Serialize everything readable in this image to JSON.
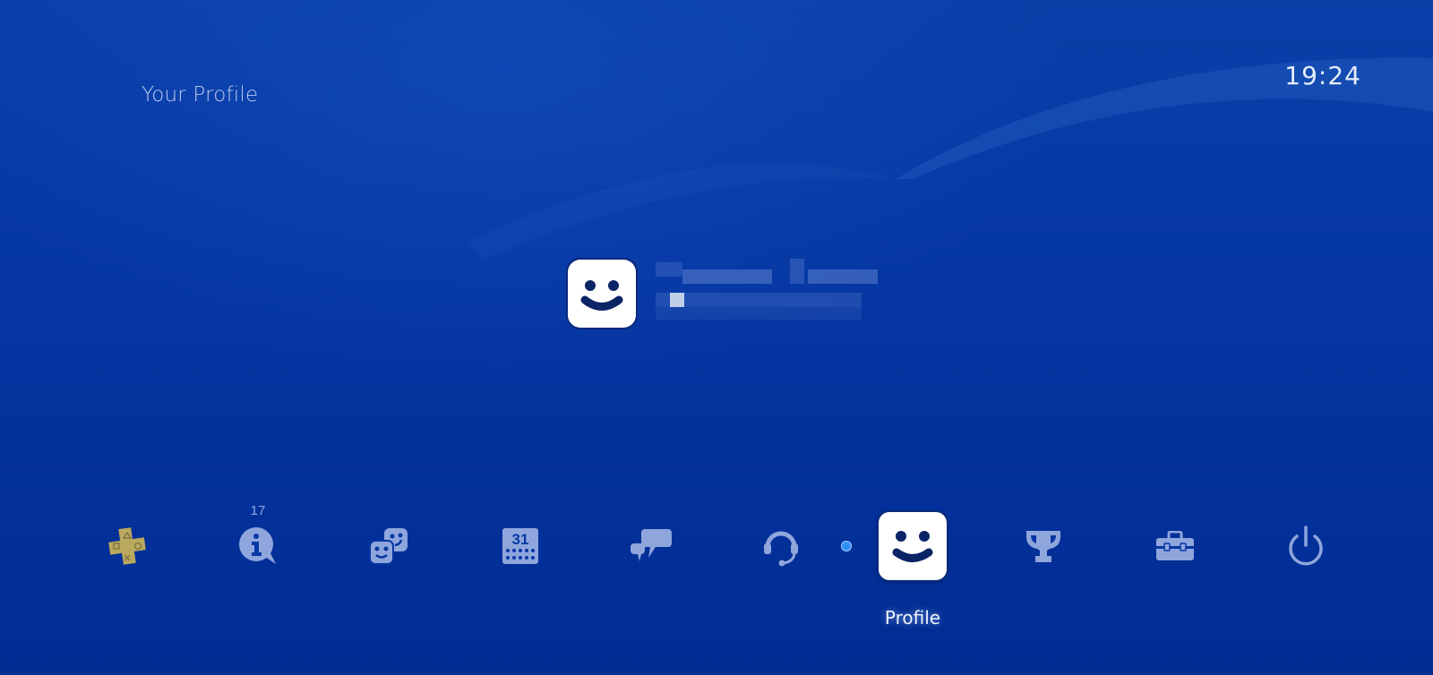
{
  "header": {
    "screen_title": "Your Profile",
    "clock": "19:24"
  },
  "profile_card": {
    "avatar_icon": "smiley-avatar-icon",
    "online_id": "[pixelated]",
    "name": "[pixelated]"
  },
  "function_bar": {
    "items": [
      {
        "id": "playstation-plus",
        "icon": "ps-plus-icon",
        "label": "PlayStation Plus"
      },
      {
        "id": "whats-new",
        "icon": "info-bubble-icon",
        "label": "What's New",
        "badge": "17"
      },
      {
        "id": "friends",
        "icon": "friends-icon",
        "label": "Friends"
      },
      {
        "id": "events",
        "icon": "calendar-icon",
        "label": "Events",
        "calendar_day": "31"
      },
      {
        "id": "messages",
        "icon": "messages-icon",
        "label": "Messages"
      },
      {
        "id": "party",
        "icon": "headset-icon",
        "label": "Party"
      },
      {
        "id": "profile",
        "icon": "smiley-avatar-icon",
        "label": "Profile",
        "selected": true
      },
      {
        "id": "trophies",
        "icon": "trophy-icon",
        "label": "Trophies"
      },
      {
        "id": "settings",
        "icon": "toolbox-icon",
        "label": "Settings"
      },
      {
        "id": "power",
        "icon": "power-icon",
        "label": "Power"
      }
    ],
    "selected_label": "Profile"
  },
  "colors": {
    "background": "#0637a3",
    "icon_inactive": "#8fa6dd",
    "ps_plus_gold": "#b9a95e",
    "selection_dot": "#2f8ff5",
    "tile_white": "#ffffff",
    "face_dark": "#0a2466"
  }
}
